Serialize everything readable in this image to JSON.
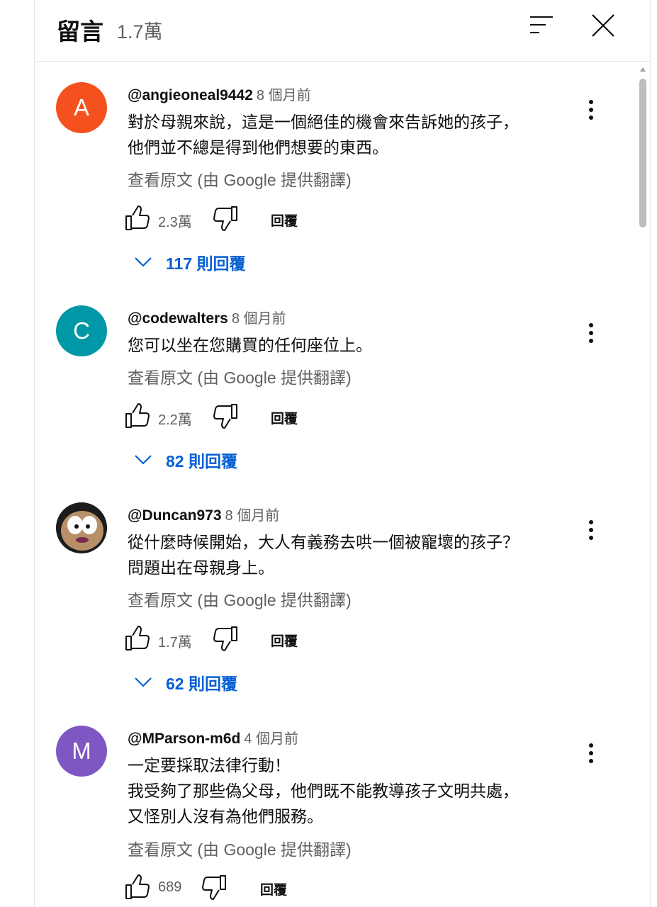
{
  "header": {
    "title": "留言",
    "count": "1.7萬",
    "sort_icon": "sort-icon",
    "close_icon": "close-icon"
  },
  "colors": {
    "link_blue": "#065fd4",
    "secondary_text": "#606060",
    "avatar_a": "#f4511e",
    "avatar_c": "#0097a7",
    "avatar_m": "#7e57c2"
  },
  "comments": [
    {
      "author": "@angieoneal9442",
      "time": "8 個月前",
      "avatar_letter": "A",
      "text": [
        "對於母親來說，這是一個絕佳的機會來告訴她的孩子，",
        "他們並不總是得到他們想要的東西。"
      ],
      "translate": "查看原文 (由 Google 提供翻譯)",
      "likes": "2.3萬",
      "reply_label": "回覆",
      "replies": "117 則回覆"
    },
    {
      "author": "@codewalters",
      "time": "8 個月前",
      "avatar_letter": "C",
      "text": [
        "您可以坐在您購買的任何座位上。"
      ],
      "translate": "查看原文 (由 Google 提供翻譯)",
      "likes": "2.2萬",
      "reply_label": "回覆",
      "replies": "82 則回覆"
    },
    {
      "author": "@Duncan973",
      "time": "8 個月前",
      "avatar_letter": "",
      "text": [
        "從什麼時候開始，大人有義務去哄一個被寵壞的孩子？",
        "問題出在母親身上。"
      ],
      "translate": "查看原文 (由 Google 提供翻譯)",
      "likes": "1.7萬",
      "reply_label": "回覆",
      "replies": "62 則回覆"
    },
    {
      "author": "@MParson-m6d",
      "time": "4 個月前",
      "avatar_letter": "M",
      "text": [
        "一定要採取法律行動！",
        "我受夠了那些偽父母，他們既不能教導孩子文明共處，",
        "又怪別人沒有為他們服務。"
      ],
      "translate": "查看原文 (由 Google 提供翻譯)",
      "likes": "689",
      "reply_label": "回覆",
      "replies": ""
    }
  ]
}
